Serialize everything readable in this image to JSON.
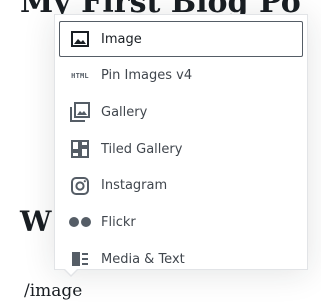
{
  "editor": {
    "title_visible_fragment": "My First Blog Po",
    "heading_fragment": "W",
    "current_block_text": "/image"
  },
  "inserter": {
    "items": [
      {
        "label": "Image",
        "icon": "image-icon",
        "selected": true
      },
      {
        "label": "Pin Images v4",
        "icon": "html-icon",
        "icon_text": "HTML"
      },
      {
        "label": "Gallery",
        "icon": "gallery-icon"
      },
      {
        "label": "Tiled Gallery",
        "icon": "tiled-gallery-icon"
      },
      {
        "label": "Instagram",
        "icon": "instagram-icon"
      },
      {
        "label": "Flickr",
        "icon": "flickr-icon"
      },
      {
        "label": "Media & Text",
        "icon": "media-text-icon"
      }
    ]
  },
  "colors": {
    "text": "#191e23",
    "icon": "#555d66",
    "selected_border": "#555d66"
  }
}
